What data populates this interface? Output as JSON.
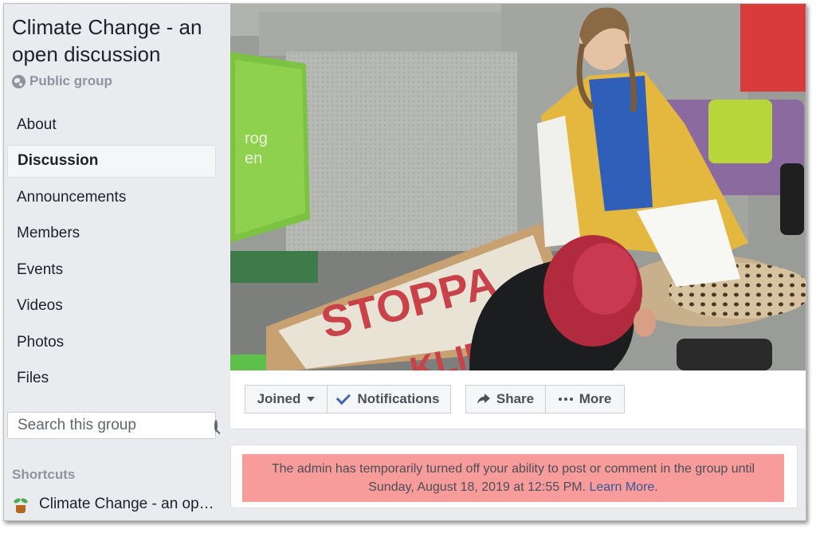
{
  "group": {
    "title": "Climate Change - an open discussion",
    "privacy": "Public group"
  },
  "nav": {
    "items": [
      {
        "label": "About",
        "active": false
      },
      {
        "label": "Discussion",
        "active": true
      },
      {
        "label": "Announcements",
        "active": false
      },
      {
        "label": "Members",
        "active": false
      },
      {
        "label": "Events",
        "active": false
      },
      {
        "label": "Videos",
        "active": false
      },
      {
        "label": "Photos",
        "active": false
      },
      {
        "label": "Files",
        "active": false
      }
    ]
  },
  "search": {
    "placeholder": "Search this group"
  },
  "shortcuts": {
    "heading": "Shortcuts",
    "items": [
      {
        "label": "Climate Change - an open discussion",
        "icon": "potted-plant-icon"
      }
    ]
  },
  "cover": {
    "sign_text": "STOPPA",
    "sign_text_2": "KLIMAT",
    "poster_text": "rog",
    "poster_text_2": "en"
  },
  "actions": {
    "joined_label": "Joined",
    "notifications_label": "Notifications",
    "share_label": "Share",
    "more_label": "More"
  },
  "notice": {
    "message": "The admin has temporarily turned off your ability to post or comment in the group until Sunday, August 18, 2019 at 12:55 PM.",
    "link_label": "Learn More",
    "trailing": "."
  },
  "colors": {
    "accent": "#4267b2",
    "notice_bg": "#f89b9b",
    "link": "#385898"
  }
}
